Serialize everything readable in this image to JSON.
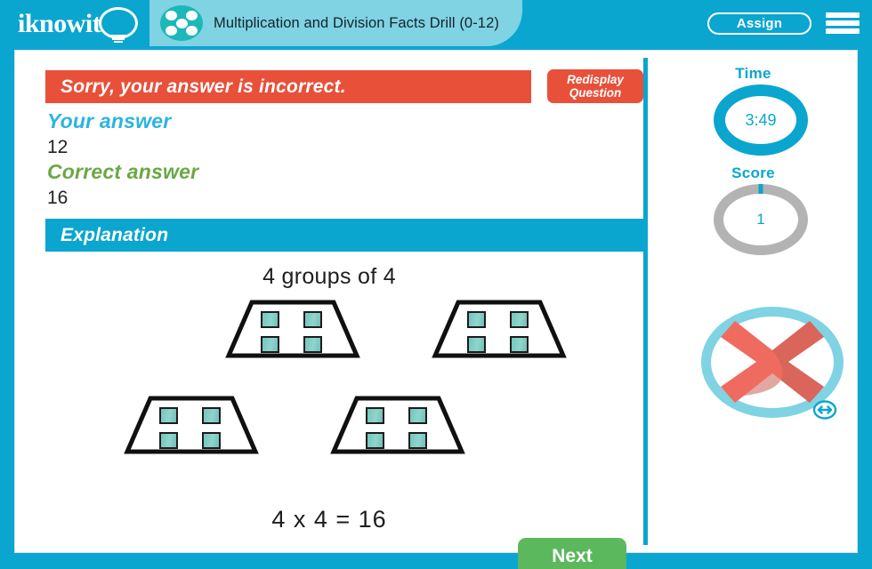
{
  "header": {
    "logo_text": "iknowit",
    "logo_icon": "lightbulb-icon",
    "subject_icon": "five-dots-icon",
    "title": "Multiplication and Division Facts Drill (0-12)",
    "assign_label": "Assign",
    "menu_icon": "hamburger-menu-icon"
  },
  "feedback": {
    "banner_text": "Sorry, your answer is incorrect.",
    "banner_color": "#e8503a",
    "redisplay_line1": "Redisplay",
    "redisplay_line2": "Question",
    "your_answer_label": "Your answer",
    "your_answer_value": "12",
    "your_answer_color": "#2cb4e0",
    "correct_answer_label": "Correct answer",
    "correct_answer_value": "16",
    "correct_answer_color": "#6aa844"
  },
  "explanation": {
    "banner_label": "Explanation",
    "banner_color": "#0aa6cf",
    "statement": "4 groups of 4",
    "equation": "4 x 4 = 16",
    "groups": [
      {
        "name": "group-1",
        "dots": 4
      },
      {
        "name": "group-2",
        "dots": 4
      },
      {
        "name": "group-3",
        "dots": 4
      },
      {
        "name": "group-4",
        "dots": 4
      }
    ],
    "square_color": "#72c6bd"
  },
  "actions": {
    "next_label": "Next",
    "next_color": "#5cb85c"
  },
  "sidebar": {
    "time_label": "Time",
    "time_value": "3:49",
    "score_label": "Score",
    "score_value": "1",
    "result_icon": "x-mark-incorrect-icon",
    "resize_icon": "horizontal-resize-icon",
    "accent_color": "#0aa6cf"
  }
}
